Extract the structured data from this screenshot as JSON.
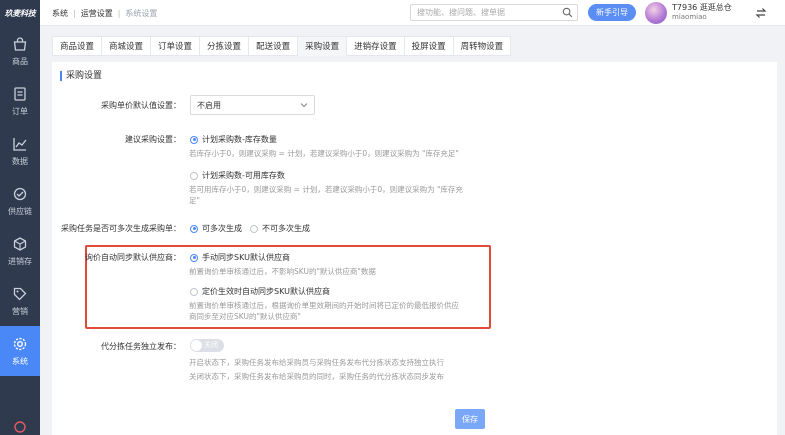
{
  "brand": {
    "logo_text": "玖麦科技"
  },
  "sidebar": {
    "items": [
      {
        "label": "商品",
        "icon": "bag-icon"
      },
      {
        "label": "订单",
        "icon": "document-icon"
      },
      {
        "label": "数据",
        "icon": "chart-icon"
      },
      {
        "label": "供应链",
        "icon": "supply-icon"
      },
      {
        "label": "进销存",
        "icon": "inventory-icon"
      },
      {
        "label": "营销",
        "icon": "tag-icon"
      },
      {
        "label": "系统",
        "icon": "gear-icon",
        "active": true
      }
    ]
  },
  "header": {
    "breadcrumb": [
      "系统",
      "运营设置",
      "系统设置"
    ],
    "search_placeholder": "搜功能、搜问题、搜单据",
    "guide_label": "新手引导",
    "user_org": "T7936 逛逛总仓",
    "user_name": "miaomiao"
  },
  "tabs": [
    "商品设置",
    "商城设置",
    "订单设置",
    "分拣设置",
    "配送设置",
    "采购设置",
    "进销存设置",
    "投屏设置",
    "周转物设置"
  ],
  "active_tab": "采购设置",
  "form": {
    "section_title": "采购设置",
    "default_price": {
      "label": "采购单价默认值设置：",
      "value": "不启用"
    },
    "suggest": {
      "label": "建议采购设置：",
      "option1": "计划采购数-库存数量",
      "hint1": "若库存小于0，则建议采购 = 计划，若建议采购小于0，则建议采购为 \"库存充足\"",
      "option2": "计划采购数-可用库存数",
      "hint2a": "若可用库存小于0，则建议采购 = 计划，若建议采购小于0，则建议采购为 \"库存充",
      "hint2b": "足\""
    },
    "multi": {
      "label": "采购任务是否可多次生成采购单：",
      "option1": "可多次生成",
      "option2": "不可多次生成"
    },
    "inquiry": {
      "label": "询价自动同步默认供应商：",
      "option1": "手动同步SKU默认供应商",
      "hint1": "前置询价单审核通过后，不影响SKU的\"默认供应商\"数据",
      "option2": "定价生效时自动同步SKU默认供应商",
      "hint2a": "前置询价单审核通过后，根据询价单里效期间的开始时间将已定价的最低报价供应",
      "hint2b": "商同步至对应SKU的\"默认供应商\""
    },
    "split_publish": {
      "label": "代分拣任务独立发布：",
      "toggle_text": "关闭",
      "toggle_on": false,
      "hint1": "开启状态下，采购任务发布给采购员与采购任务发布代分拣状态支持独立执行",
      "hint2": "关闭状态下，采购任务发布给采购员的同时，采购任务的代分拣状态同步发布"
    },
    "save_label": "保存"
  },
  "colors": {
    "sidebar_bg": "#2f3a4e",
    "accent": "#4a88f7",
    "highlight_box": "#e0493c"
  }
}
